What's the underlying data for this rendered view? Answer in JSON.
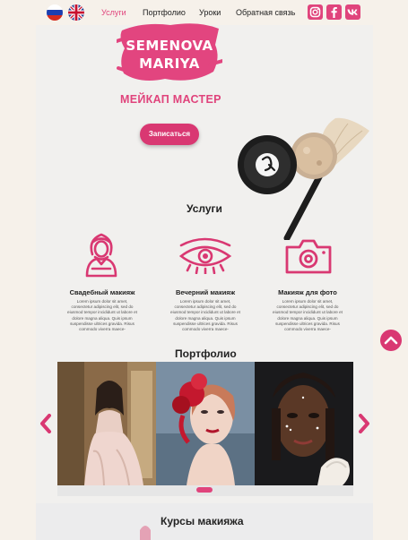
{
  "nav": {
    "languages": [
      "ru-flag",
      "uk-flag"
    ],
    "links": [
      {
        "label": "Услуги",
        "active": true
      },
      {
        "label": "Портфолио",
        "active": false
      },
      {
        "label": "Уроки",
        "active": false
      },
      {
        "label": "Обратная связь",
        "active": false
      }
    ],
    "social": [
      "instagram-icon",
      "facebook-icon",
      "vk-icon"
    ]
  },
  "hero": {
    "logo_line1": "SEMENOVA",
    "logo_line2": "MARIYA",
    "title": "МЕЙКАП МАСТЕР",
    "button": "Записаться"
  },
  "services": {
    "title": "Услуги",
    "items": [
      {
        "icon": "bride-icon",
        "title": "Свадебный макияж",
        "desc": "Lorem ipsum dolor sit amet, consectetur adipiscing elit, sed do eiusmod tempor incididunt ut labore et dolore magna aliqua. Quis ipsum suspendisse ultrices gravida. Risus commodo viverra maece-"
      },
      {
        "icon": "eye-makeup-icon",
        "title": "Вечерний макияж",
        "desc": "Lorem ipsum dolor sit amet, consectetur adipiscing elit, sed do eiusmod tempor incididunt ut labore et dolore magna aliqua. Quis ipsum suspendisse ultrices gravida. Risus commodo viverra maece-"
      },
      {
        "icon": "camera-icon",
        "title": "Макияж для фото",
        "desc": "Lorem ipsum dolor sit amet, consectetur adipiscing elit, sed do eiusmod tempor incididunt ut labore et dolore magna aliqua. Quis ipsum suspendisse ultrices gravida. Risus commodo viverra maece-"
      }
    ]
  },
  "portfolio": {
    "title": "Портфолио"
  },
  "courses": {
    "title": "Курсы макияжа"
  },
  "colors": {
    "accent": "#e0447c",
    "button": "#d93872",
    "card_bg": "#f1f0ee",
    "page_bg": "#f6f1ea"
  }
}
